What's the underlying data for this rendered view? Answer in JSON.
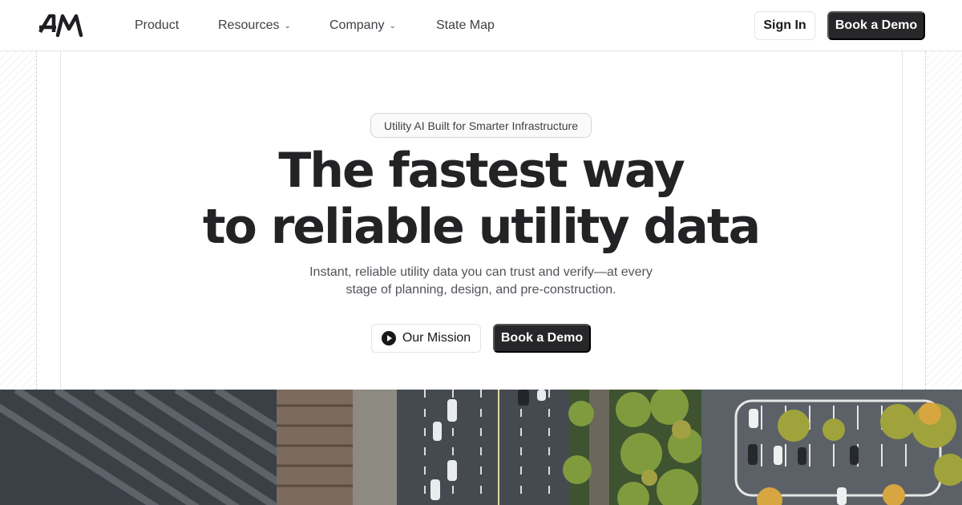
{
  "brand": {
    "logo_text": "4M"
  },
  "nav": {
    "items": [
      {
        "label": "Product",
        "has_dropdown": false
      },
      {
        "label": "Resources",
        "has_dropdown": true
      },
      {
        "label": "Company",
        "has_dropdown": true
      },
      {
        "label": "State Map",
        "has_dropdown": false
      }
    ],
    "sign_in_label": "Sign In",
    "book_demo_label": "Book a Demo"
  },
  "hero": {
    "badge": "Utility AI Built for Smarter Infrastructure",
    "headline_line1": "The fastest way",
    "headline_line2": "to reliable utility data",
    "subtext_line1": "Instant, reliable utility data you can trust and verify—at every",
    "subtext_line2": "stage of planning, design, and pre-construction.",
    "mission_label": "Our Mission",
    "demo_label": "Book a Demo"
  },
  "icons": {
    "mission": "play-circle-icon",
    "dropdown": "chevron-down-icon"
  },
  "colors": {
    "text": "#232326",
    "dark_button": "#27272a",
    "border": "#e4e4e7"
  }
}
